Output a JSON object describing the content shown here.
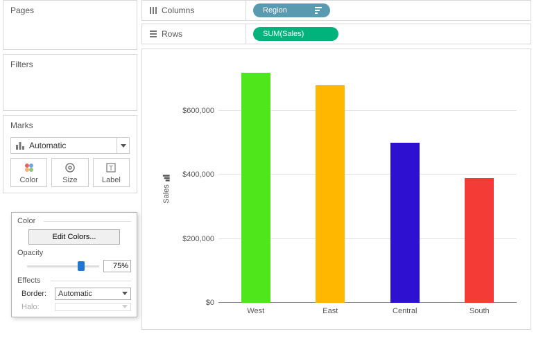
{
  "panels": {
    "pages_title": "Pages",
    "filters_title": "Filters",
    "marks_title": "Marks"
  },
  "marks": {
    "type_label": "Automatic",
    "buttons": {
      "color": "Color",
      "size": "Size",
      "label": "Label"
    }
  },
  "shelves": {
    "columns_label": "Columns",
    "rows_label": "Rows",
    "columns_pill": "Region",
    "rows_pill": "SUM(Sales)"
  },
  "color_popup": {
    "section_color": "Color",
    "edit_colors": "Edit Colors...",
    "section_opacity": "Opacity",
    "opacity_value": "75%",
    "opacity_fraction": 0.75,
    "section_effects": "Effects",
    "border_label": "Border:",
    "border_value": "Automatic",
    "halo_label": "Halo:",
    "halo_value": ""
  },
  "chart": {
    "y_title": "Sales",
    "y_ticks": [
      "$0",
      "$200,000",
      "$400,000",
      "$600,000"
    ],
    "categories": [
      "West",
      "East",
      "Central",
      "South"
    ]
  },
  "chart_data": {
    "type": "bar",
    "title": "",
    "xlabel": "",
    "ylabel": "Sales",
    "categories": [
      "West",
      "East",
      "Central",
      "South"
    ],
    "values": [
      720000,
      680000,
      500000,
      390000
    ],
    "colors": [
      "#4fe61c",
      "#ffb700",
      "#2e10d0",
      "#f53b36"
    ],
    "ylim": [
      0,
      750000
    ],
    "y_ticks": [
      0,
      200000,
      400000,
      600000
    ],
    "y_tick_labels": [
      "$0",
      "$200,000",
      "$400,000",
      "$600,000"
    ]
  }
}
